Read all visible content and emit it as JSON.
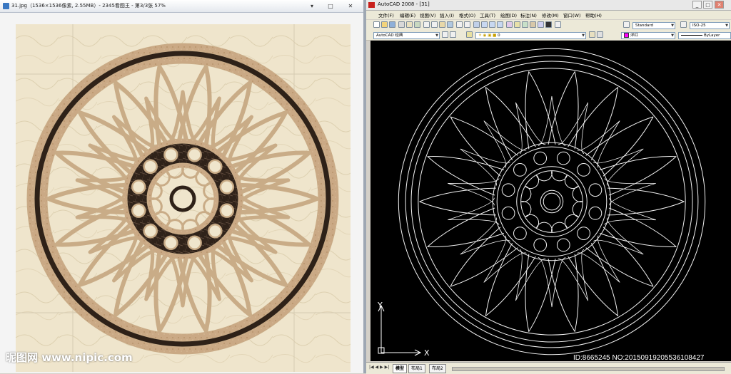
{
  "viewer": {
    "title": "31.jpg（1536×1536像素, 2.55MB）- 2345看图王 - 第3/3张 57%",
    "window_buttons": [
      "▾",
      "□",
      "✕"
    ],
    "watermark": "昵图网 www.nipic.com"
  },
  "cad": {
    "title": "AutoCAD 2008 - [31]",
    "window_buttons": [
      "_",
      "□",
      "✕"
    ],
    "menu": [
      "文件(F)",
      "编辑(E)",
      "视图(V)",
      "插入(I)",
      "格式(O)",
      "工具(T)",
      "绘图(D)",
      "标注(N)",
      "修改(M)",
      "窗口(W)",
      "帮助(H)"
    ],
    "workspace": "AutoCAD 经典",
    "layer": "0",
    "text_style": "Standard",
    "dim_style": "ISO-25",
    "color": "洋红",
    "linetype": "ByLayer",
    "ucs_y": "Y",
    "ucs_x": "X",
    "tabs": [
      "模型",
      "布局1",
      "布局2"
    ],
    "tab_nav": "|◀ ◀ ▶ ▶|"
  },
  "footer_id": "ID:8665245 NO:20150919205536108427",
  "colors": {
    "background_stone": "#eee3c9",
    "beige_band": "#c9ac87",
    "dark_marble": "#2e2118",
    "cad_canvas": "#000000",
    "cad_lines": "#f2f2f2"
  }
}
